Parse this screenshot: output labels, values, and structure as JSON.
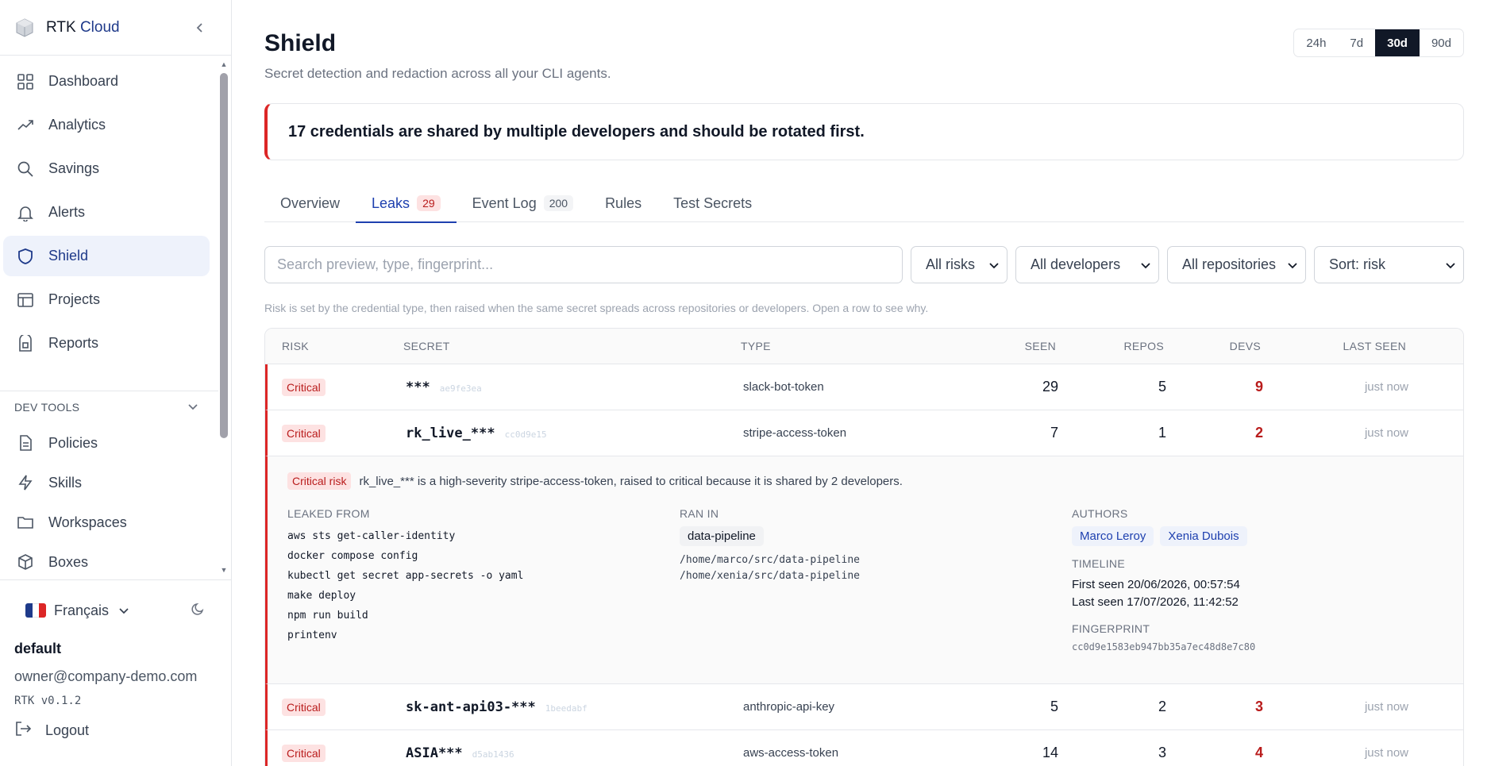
{
  "brand": {
    "prefix": "RTK",
    "suffix": "Cloud"
  },
  "nav": [
    {
      "label": "Dashboard",
      "icon": "dashboard-icon"
    },
    {
      "label": "Analytics",
      "icon": "analytics-icon"
    },
    {
      "label": "Savings",
      "icon": "search-icon"
    },
    {
      "label": "Alerts",
      "icon": "bell-icon"
    },
    {
      "label": "Shield",
      "icon": "shield-icon",
      "active": true
    },
    {
      "label": "Projects",
      "icon": "projects-icon"
    },
    {
      "label": "Reports",
      "icon": "reports-icon"
    }
  ],
  "dev_tools": {
    "title": "DEV TOOLS",
    "items": [
      {
        "label": "Policies",
        "icon": "document-icon"
      },
      {
        "label": "Skills",
        "icon": "lightning-icon"
      },
      {
        "label": "Workspaces",
        "icon": "folder-icon"
      },
      {
        "label": "Boxes",
        "icon": "box-icon"
      }
    ]
  },
  "footer": {
    "language": "Français",
    "org": "default",
    "email": "owner@company-demo.com",
    "version": "RTK v0.1.2",
    "logout": "Logout"
  },
  "page": {
    "title": "Shield",
    "subtitle": "Secret detection and redaction across all your CLI agents.",
    "ranges": [
      "24h",
      "7d",
      "30d",
      "90d"
    ],
    "active_range": "30d",
    "alert": "17 credentials are shared by multiple developers and should be rotated first."
  },
  "tabs": [
    {
      "label": "Overview",
      "badge": ""
    },
    {
      "label": "Leaks",
      "badge": "29"
    },
    {
      "label": "Event Log",
      "badge": "200"
    },
    {
      "label": "Rules",
      "badge": ""
    },
    {
      "label": "Test Secrets",
      "badge": ""
    }
  ],
  "filters": {
    "search_placeholder": "Search preview, type, fingerprint...",
    "risk": "All risks",
    "developers": "All developers",
    "repositories": "All repositories",
    "sort": "Sort: risk"
  },
  "hint": "Risk is set by the credential type, then raised when the same secret spreads across repositories or developers. Open a row to see why.",
  "table": {
    "headers": {
      "risk": "RISK",
      "secret": "SECRET",
      "type": "TYPE",
      "seen": "SEEN",
      "repos": "REPOS",
      "devs": "DEVS",
      "last": "LAST SEEN"
    },
    "rows": [
      {
        "risk": "Critical",
        "secret": "***",
        "fp": "ae9fe3ea",
        "type": "slack-bot-token",
        "seen": "29",
        "repos": "5",
        "devs": "9",
        "last": "just now"
      },
      {
        "risk": "Critical",
        "secret": "rk_live_***",
        "fp": "cc0d9e15",
        "type": "stripe-access-token",
        "seen": "7",
        "repos": "1",
        "devs": "2",
        "last": "just now"
      },
      {
        "risk": "Critical",
        "secret": "sk-ant-api03-***",
        "fp": "1beedabf",
        "type": "anthropic-api-key",
        "seen": "5",
        "repos": "2",
        "devs": "3",
        "last": "just now"
      },
      {
        "risk": "Critical",
        "secret": "ASIA***",
        "fp": "d5ab1436",
        "type": "aws-access-token",
        "seen": "14",
        "repos": "3",
        "devs": "4",
        "last": "just now"
      }
    ]
  },
  "detail": {
    "badge": "Critical risk",
    "summary": "rk_live_*** is a high-severity stripe-access-token, raised to critical because it is shared by 2 developers.",
    "leaked_from_title": "LEAKED FROM",
    "leaked_from": [
      "aws sts get-caller-identity",
      "docker compose config",
      "kubectl get secret app-secrets -o yaml",
      "make deploy",
      "npm run build",
      "printenv"
    ],
    "ran_in_title": "RAN IN",
    "ran_in_repo": "data-pipeline",
    "ran_in_paths": [
      "/home/marco/src/data-pipeline",
      "/home/xenia/src/data-pipeline"
    ],
    "authors_title": "AUTHORS",
    "authors": [
      "Marco Leroy",
      "Xenia Dubois"
    ],
    "timeline_title": "TIMELINE",
    "first_seen": "First seen 20/06/2026, 00:57:54",
    "last_seen": "Last seen 17/07/2026, 11:42:52",
    "fingerprint_title": "FINGERPRINT",
    "fingerprint": "cc0d9e1583eb947bb35a7ec48d8e7c80"
  },
  "colors": {
    "accent": "#1e40af",
    "critical": "#dc2626",
    "critical_bg": "#fde2e2"
  }
}
